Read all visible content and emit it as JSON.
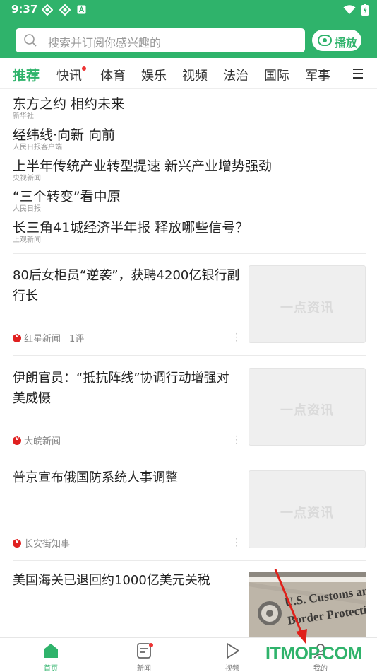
{
  "status_bar": {
    "time": "9:37"
  },
  "header": {
    "search_placeholder": "搜索并订阅你感兴趣的",
    "play_label": "播放"
  },
  "tabs": [
    {
      "label": "推荐",
      "active": true
    },
    {
      "label": "快讯",
      "badge": true
    },
    {
      "label": "体育"
    },
    {
      "label": "娱乐"
    },
    {
      "label": "视频"
    },
    {
      "label": "法治"
    },
    {
      "label": "国际"
    },
    {
      "label": "军事"
    }
  ],
  "headlines": [
    {
      "title": "东方之约 相约未来",
      "source": "新华社"
    },
    {
      "title": "经纬线·向新 向前",
      "source": "人民日报客户端"
    },
    {
      "title": "上半年传统产业转型提速 新兴产业增势强劲",
      "source": "央视新闻"
    },
    {
      "title": "“三个转变”看中原",
      "source": "人民日报"
    },
    {
      "title": "长三角41城经济半年报 释放哪些信号？",
      "source": "上观新闻"
    }
  ],
  "articles": [
    {
      "title": "80后女柜员“逆袭”，获聘4200亿银行副行长",
      "source": "红星新闻",
      "comments": "1评",
      "thumb_text": "一点资讯"
    },
    {
      "title": "伊朗官员：“抵抗阵线”协调行动增强对美威慑",
      "source": "大皖新闻",
      "thumb_text": "一点资讯"
    },
    {
      "title": "普京宣布俄国防系统人事调整",
      "source": "长安街知事",
      "thumb_text": "一点资讯"
    },
    {
      "title": "美国海关已退回约1000亿美元关税",
      "photo_text": "U.S. Customs and Border Protection"
    }
  ],
  "bottom_nav": [
    {
      "label": "首页",
      "active": true
    },
    {
      "label": "新闻",
      "badge": true
    },
    {
      "label": "视频"
    },
    {
      "label": "我的"
    }
  ],
  "watermark": "ITMOP.COM",
  "colors": {
    "brand": "#2fb36b",
    "badge": "#e33333",
    "source_icon": "#e02020"
  }
}
